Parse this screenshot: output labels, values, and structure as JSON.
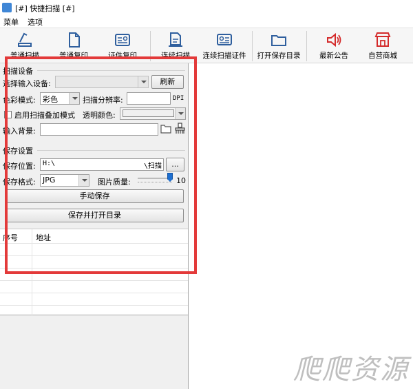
{
  "window": {
    "title": "[#] 快捷扫描 [#]"
  },
  "menu": {
    "items": [
      "菜单",
      "选项"
    ]
  },
  "toolbar": {
    "buttons": [
      {
        "label": "普通扫描"
      },
      {
        "label": "普通复印"
      },
      {
        "label": "证件复印"
      },
      {
        "label": "连续扫描"
      },
      {
        "label": "连续扫描证件"
      },
      {
        "label": "打开保存目录"
      },
      {
        "label": "最新公告"
      },
      {
        "label": "自营商城"
      }
    ]
  },
  "scan_settings": {
    "group_title": "扫描设备",
    "device_label": "选择输入设备:",
    "device_value": "",
    "refresh_label": "刷新",
    "color_mode_label": "色彩模式:",
    "color_mode_value": "彩色",
    "resolution_label": "扫描分辨率:",
    "resolution_value": "",
    "resolution_unit": "DPI",
    "overlay_label": "启用扫描叠加模式",
    "overlay_checked": false,
    "transparent_color_label": "透明颜色:",
    "background_label": "输入背景:",
    "background_value": ""
  },
  "save_settings": {
    "group_title": "保存设置",
    "path_label": "保存位置:",
    "path_value": "H:\\",
    "path_suffix": "\\扫描",
    "browse_label": "...",
    "format_label": "保存格式:",
    "format_value": "JPG",
    "quality_label": "图片质量:",
    "quality_value": "10",
    "manual_save_label": "手动保存",
    "save_open_label": "保存并打开目录"
  },
  "file_table": {
    "columns": [
      "序号",
      "地址"
    ],
    "rows": []
  },
  "watermark": "爬爬资源",
  "colors": {
    "highlight": "#e33a3a",
    "toolbar_icon": "#2f5f9e",
    "accent_red": "#d42b2b"
  }
}
